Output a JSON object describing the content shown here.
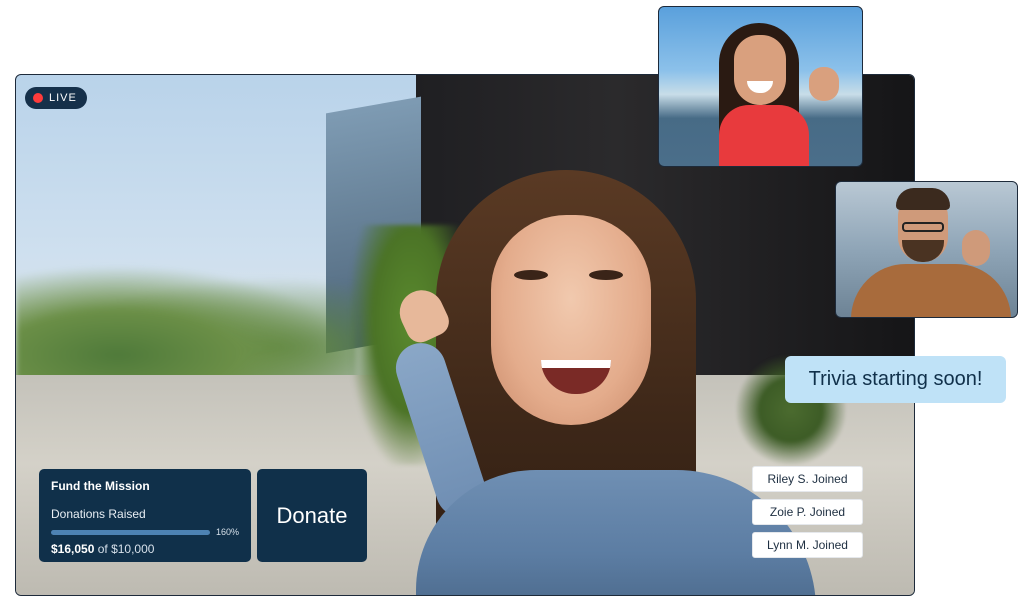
{
  "live_badge": {
    "label": "LIVE",
    "color": "#ff3b3b"
  },
  "fundraiser": {
    "title": "Fund the Mission",
    "subtitle": "Donations Raised",
    "progress_percent": 160,
    "progress_label": "160%",
    "raised": "$16,050",
    "goal_text": " of $10,000"
  },
  "donate_button": {
    "label": "Donate"
  },
  "joins": [
    "Riley S. Joined",
    "Zoie P. Joined",
    "Lynn M. Joined"
  ],
  "chat_bubble": {
    "text": "Trivia starting soon!"
  },
  "colors": {
    "panel": "#10304a",
    "bubble": "#bfe2f7",
    "accent": "#4d82b3"
  }
}
